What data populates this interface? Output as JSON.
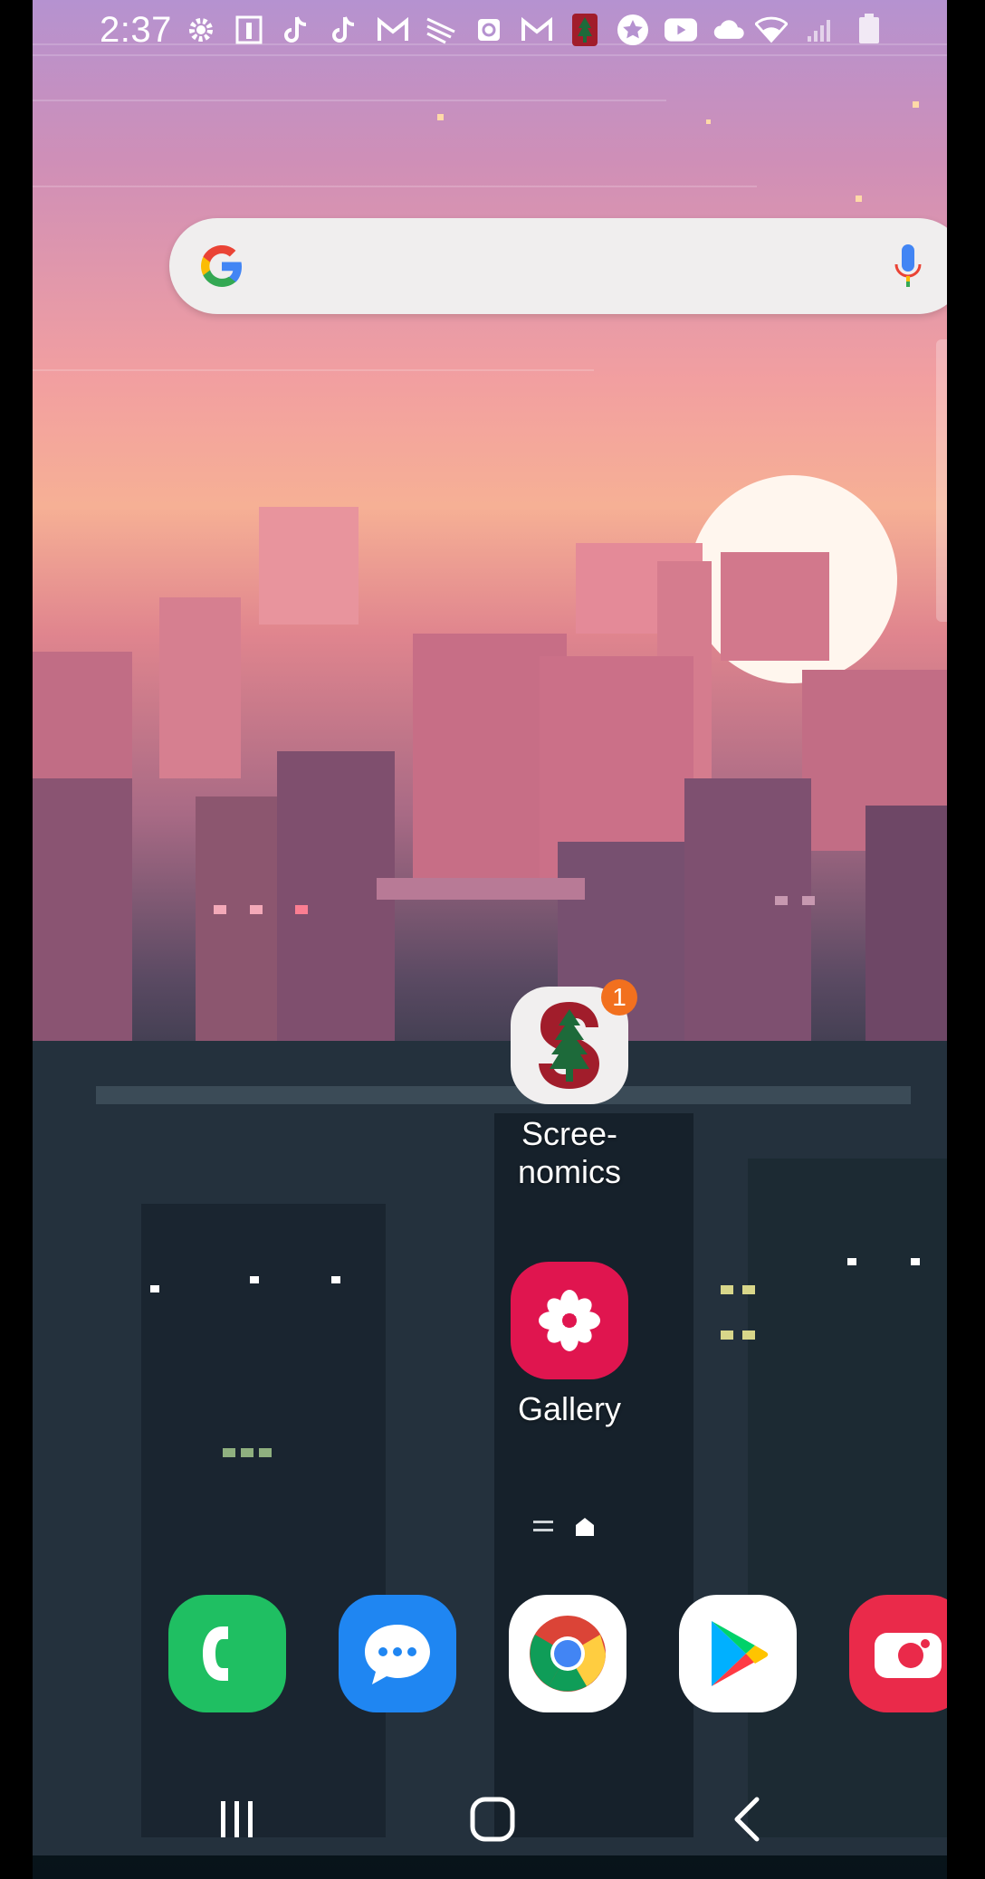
{
  "status_bar": {
    "time": "2:37",
    "notification_icons": [
      "settings-icon",
      "tool-icon",
      "tiktok-icon",
      "tiktok-icon",
      "gmail-icon",
      "sprint-icon",
      "alarm-icon",
      "gmail-icon",
      "stanford-icon",
      "star-icon",
      "youtube-icon",
      "cloud-icon"
    ],
    "system_icons": [
      "wifi-icon",
      "signal-icon",
      "battery-icon"
    ]
  },
  "search_bar": {
    "logo": "google-g-icon",
    "voice": "mic-icon"
  },
  "apps": [
    {
      "label": "Scree-\nnomics",
      "line1": "Scree-",
      "line2": "nomics",
      "icon": "stanford-tree-icon",
      "badge": "1"
    },
    {
      "label": "Gallery",
      "icon": "flower-icon"
    }
  ],
  "page_indicator": {
    "icons": [
      "menu-lines-icon",
      "home-icon"
    ]
  },
  "dock": [
    {
      "name": "phone",
      "icon": "phone-icon",
      "color": "#1fbf62"
    },
    {
      "name": "messages",
      "icon": "messages-icon",
      "color": "#1f86f2"
    },
    {
      "name": "chrome",
      "icon": "chrome-icon",
      "color": "#ffffff"
    },
    {
      "name": "play-store",
      "icon": "play-store-icon",
      "color": "#ffffff"
    },
    {
      "name": "camera",
      "icon": "camera-icon",
      "color": "#ea2a4a"
    }
  ],
  "nav_bar": {
    "buttons": [
      "recents-icon",
      "home-button-icon",
      "back-icon"
    ]
  }
}
